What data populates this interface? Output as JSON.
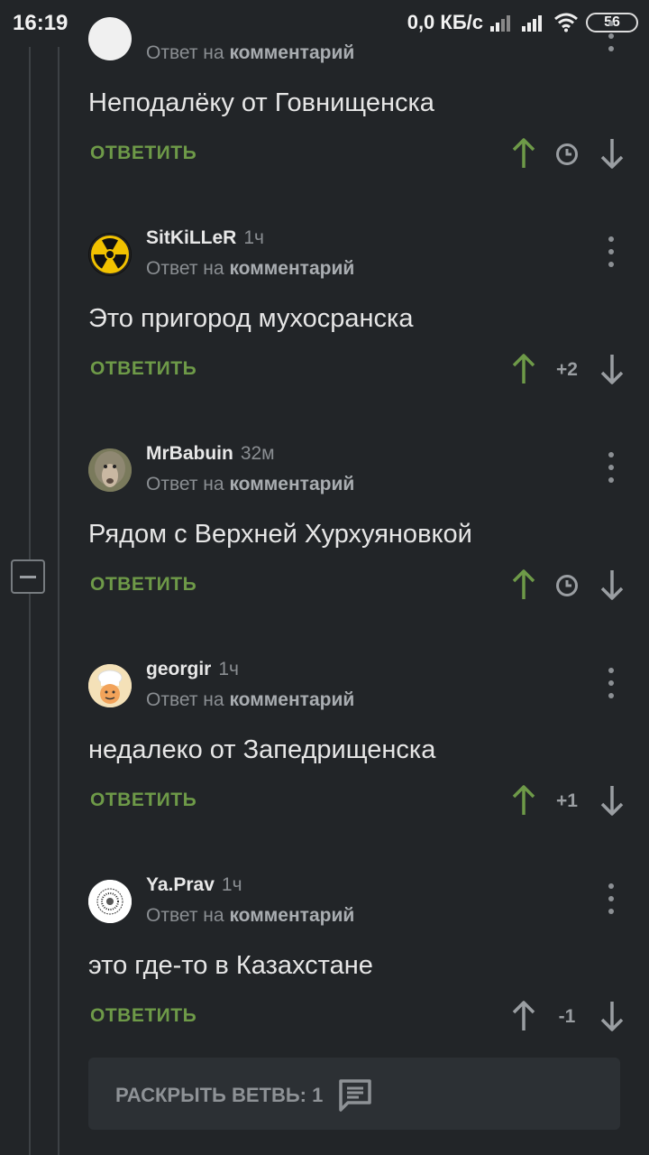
{
  "status_bar": {
    "time": "16:19",
    "network_speed": "0,0 КБ/с",
    "battery": "56",
    "icons": [
      "signal-icon",
      "signal-icon",
      "wifi-icon",
      "battery-icon"
    ]
  },
  "comments": [
    {
      "author": "",
      "time": "",
      "reply_prefix": "Ответ на",
      "reply_target": "комментарий",
      "text": "Неподалёку от Говнищенска",
      "reply_label": "ОТВЕТИТЬ",
      "rating": "",
      "rating_hidden": true,
      "upvoted": true
    },
    {
      "author": "SitKiLLeR",
      "time": "1ч",
      "reply_prefix": "Ответ на",
      "reply_target": "комментарий",
      "text": "Это пригород мухосранска",
      "reply_label": "ОТВЕТИТЬ",
      "rating": "+2",
      "rating_hidden": false,
      "upvoted": true
    },
    {
      "author": "MrBabuin",
      "time": "32м",
      "reply_prefix": "Ответ на",
      "reply_target": "комментарий",
      "text": "Рядом с Верхней Хурхуяновкой",
      "reply_label": "ОТВЕТИТЬ",
      "rating": "",
      "rating_hidden": true,
      "upvoted": true
    },
    {
      "author": "georgir",
      "time": "1ч",
      "reply_prefix": "Ответ на",
      "reply_target": "комментарий",
      "text": "недалеко от Запедрищенска",
      "reply_label": "ОТВЕТИТЬ",
      "rating": "+1",
      "rating_hidden": false,
      "upvoted": true
    },
    {
      "author": "Ya.Prav",
      "time": "1ч",
      "reply_prefix": "Ответ на",
      "reply_target": "комментарий",
      "text": "это где-то в Казахстане",
      "reply_label": "ОТВЕТИТЬ",
      "rating": "-1",
      "rating_hidden": false,
      "upvoted": false
    }
  ],
  "expand_branch": {
    "label": "РАСКРЫТЬ ВЕТВЬ: 1",
    "icon": "comment-icon"
  },
  "colors": {
    "background": "#222528",
    "accent_green": "#6e9a48",
    "muted": "#8a8e92"
  }
}
